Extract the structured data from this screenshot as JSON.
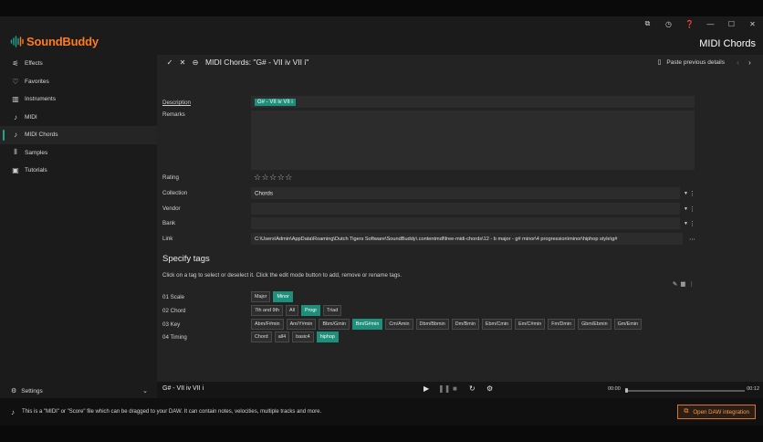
{
  "app": {
    "name": "SoundBuddy",
    "page_title": "MIDI Chords",
    "window_controls": [
      "popout-icon",
      "history-icon",
      "help-icon",
      "minimize-icon",
      "maximize-icon",
      "close-icon"
    ],
    "accent": "#1fa58c",
    "brand_color": "#ff7a21"
  },
  "sidebar": {
    "items": [
      {
        "label": "Effects",
        "icon": "sliders-icon",
        "glyph": "⚟",
        "active": false
      },
      {
        "label": "Favorites",
        "icon": "heart-icon",
        "glyph": "♡",
        "active": false
      },
      {
        "label": "Instruments",
        "icon": "piano-icon",
        "glyph": "▥",
        "active": false
      },
      {
        "label": "MIDI",
        "icon": "music-note-icon",
        "glyph": "♪",
        "active": false
      },
      {
        "label": "MIDI Chords",
        "icon": "music-note-icon",
        "glyph": "♪",
        "active": true
      },
      {
        "label": "Samples",
        "icon": "waveform-icon",
        "glyph": "⦀",
        "active": false
      },
      {
        "label": "Tutorials",
        "icon": "video-library-icon",
        "glyph": "▣",
        "active": false
      }
    ],
    "settings_label": "Settings"
  },
  "toolbar": {
    "title": "MIDI Chords: \"G# - VII iv VII i\"",
    "paste_label": "Paste previous details"
  },
  "form": {
    "description_label": "Description",
    "description_value": "G# - VII iv VII i",
    "remarks_label": "Remarks",
    "remarks_value": "",
    "rating_label": "Rating",
    "rating_stars": "☆☆☆☆☆",
    "rating_value": 0,
    "collection_label": "Collection",
    "collection_value": "Chords",
    "vendor_label": "Vendor",
    "vendor_value": "",
    "bank_label": "Bank",
    "bank_value": "",
    "link_label": "Link",
    "link_value": "C:\\Users\\Admin\\AppData\\Roaming\\Dutch Tigers Software\\SoundBuddy\\.contentmdl\\free-midi-chords\\12 - b major - g# minor\\4 progression\\minor\\hiphop style\\g#"
  },
  "tags": {
    "section_title": "Specify tags",
    "hint": "Click on a tag to select or deselect it. Click the edit mode button to add, remove or rename tags.",
    "rows": [
      {
        "label": "01 Scale",
        "chips": [
          {
            "text": "Major",
            "selected": false
          },
          {
            "text": "Minor",
            "selected": true
          }
        ]
      },
      {
        "label": "02 Chord",
        "chips": [
          {
            "text": "7th and 9th",
            "selected": false
          },
          {
            "text": "All",
            "selected": false
          },
          {
            "text": "Progr",
            "selected": true
          },
          {
            "text": "Triad",
            "selected": false
          }
        ]
      },
      {
        "label": "03 Key",
        "chips": [
          {
            "text": "Abm/F#min",
            "selected": false
          },
          {
            "text": "Am/Y#min",
            "selected": false
          },
          {
            "text": "Bbm/Gmin",
            "selected": false
          },
          {
            "text": "Bm/G#min",
            "selected": true
          },
          {
            "text": "Cm/Amin",
            "selected": false
          },
          {
            "text": "Dbm/Bbmin",
            "selected": false
          },
          {
            "text": "Dm/Bmin",
            "selected": false
          },
          {
            "text": "Ebm/Cmin",
            "selected": false
          },
          {
            "text": "Em/C#min",
            "selected": false
          },
          {
            "text": "Fm/Dmin",
            "selected": false
          },
          {
            "text": "Gbm/Ebmin",
            "selected": false
          },
          {
            "text": "Gm/Emin",
            "selected": false
          }
        ]
      },
      {
        "label": "04 Timing",
        "chips": [
          {
            "text": "Chord",
            "selected": false
          },
          {
            "text": "all4",
            "selected": false
          },
          {
            "text": "basic4",
            "selected": false
          },
          {
            "text": "hiphop",
            "selected": true
          }
        ]
      }
    ]
  },
  "player": {
    "title": "G# - VII iv VII i",
    "time_current": "00:00",
    "time_total": "00:12",
    "progress": 0
  },
  "status": {
    "text": "This is a \"MIDI\" or \"Score\" file which can be dragged to your DAW. It can contain notes, velocities, multiple tracks and more.",
    "daw_button": "Open DAW integration"
  }
}
